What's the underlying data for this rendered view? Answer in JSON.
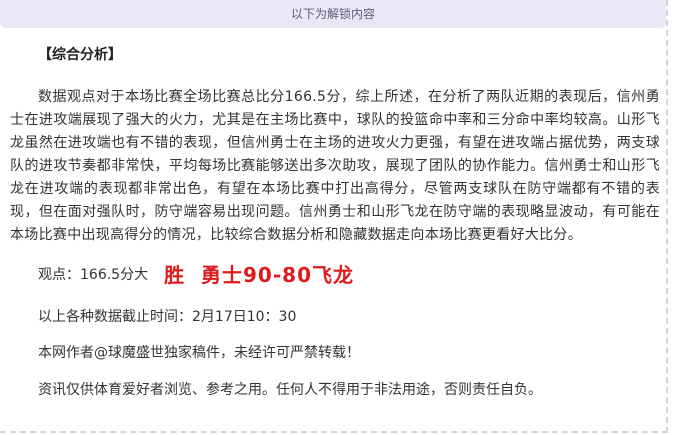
{
  "unlock_notice": "以下为解锁内容",
  "section_title": "【综合分析】",
  "analysis_text": "数据观点对于本场比赛全场比赛总比分166.5分，综上所述，在分析了两队近期的表现后，信州勇士在进攻端展现了强大的火力，尤其是在主场比赛中，球队的投篮命中率和三分命中率均较高。山形飞龙虽然在进攻端也有不错的表现，但信州勇士在主场的进攻火力更强，有望在进攻端占据优势，两支球队的进攻节奏都非常快，平均每场比赛能够送出多次助攻，展现了团队的协作能力。信州勇士和山形飞龙在进攻端的表现都非常出色，有望在本场比赛中打出高得分，尽管两支球队在防守端都有不错的表现，但在面对强队时，防守端容易出现问题。信州勇士和山形飞龙在防守端的表现略显波动，有可能在本场比赛中出现高得分的情况，比较综合数据分析和隐藏数据走向本场比赛更看好大比分。",
  "prediction": {
    "label": "观点：166.5分大",
    "pick": "胜  勇士90-80飞龙",
    "pick_color": "#e0191b"
  },
  "deadline_text": "以上各种数据截止时间：2月17日10：30",
  "author_text": "本网作者@球魔盛世独家稿件，未经许可严禁转载！",
  "disclaimer_text": "资讯仅供体育爱好者浏览、参考之用。任何人不得用于非法用途，否则责任自负。"
}
